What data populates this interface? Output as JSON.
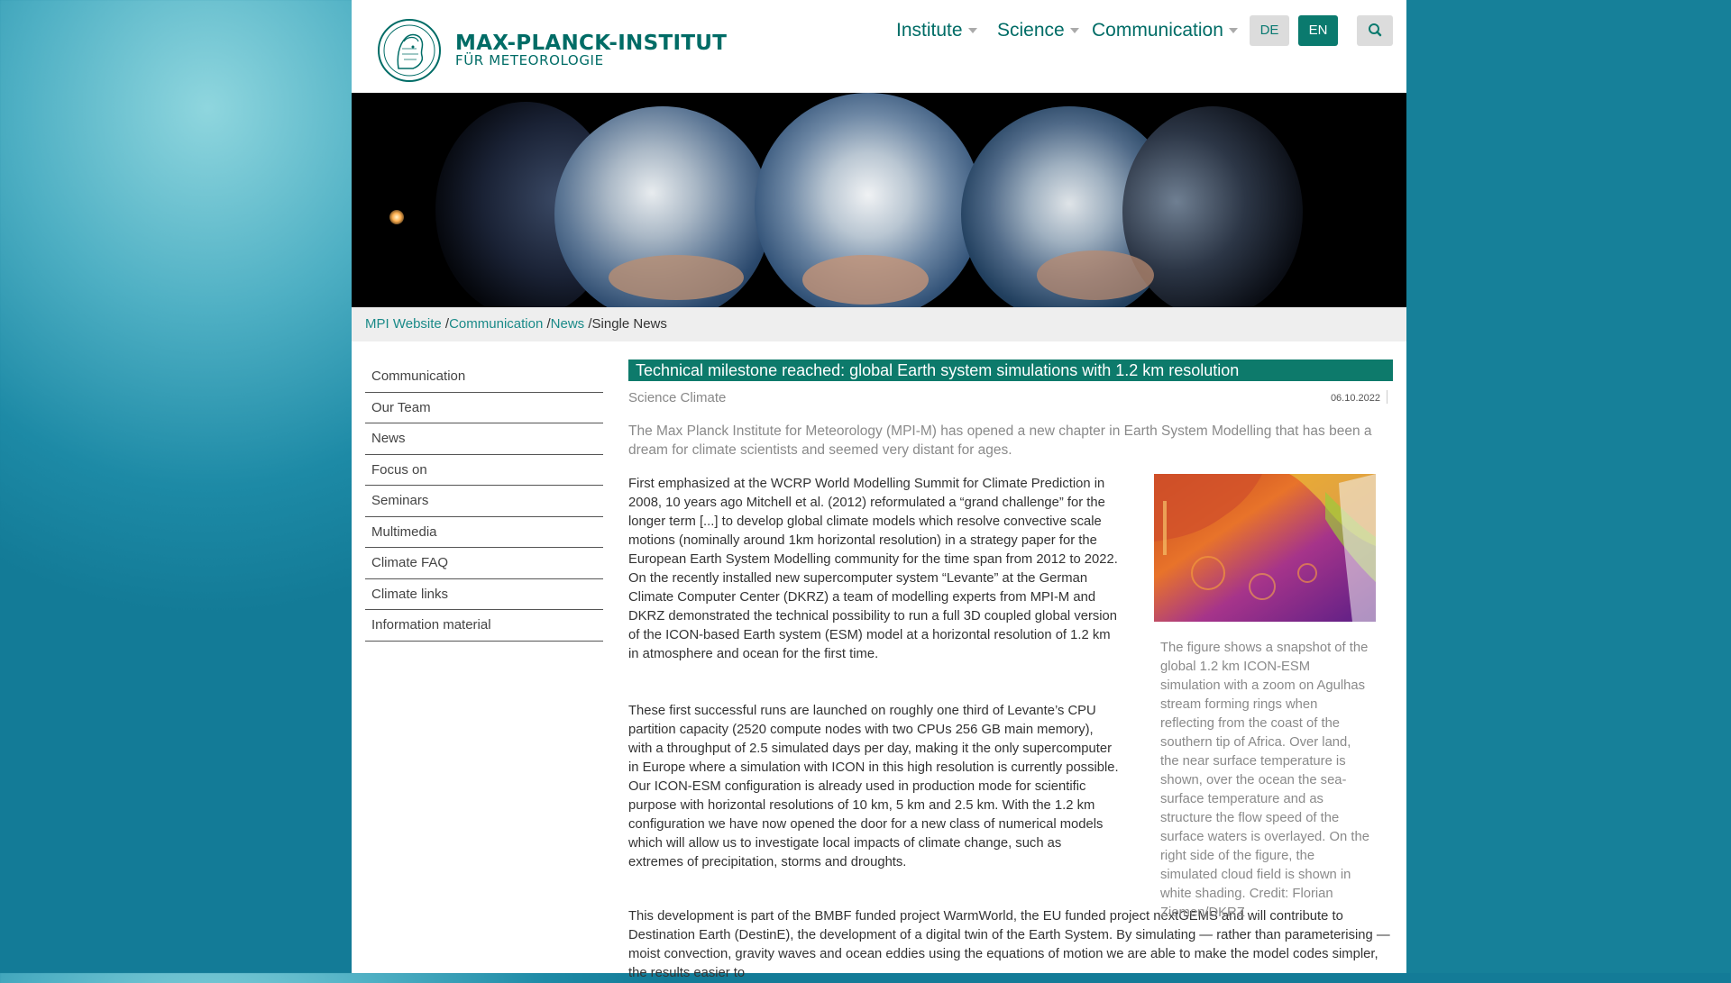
{
  "header": {
    "logo_title": "MAX-PLANCK-INSTITUT",
    "logo_subtitle": "FÜR METEOROLOGIE",
    "nav": [
      "Institute",
      "Science",
      "Communication"
    ],
    "lang_de": "DE",
    "lang_en": "EN",
    "search_icon": "search-icon"
  },
  "breadcrumb": {
    "items": [
      "MPI Website",
      "Communication",
      "News"
    ],
    "current": "Single News",
    "separator": " /"
  },
  "sidebar": {
    "items": [
      "Communication",
      "Our Team",
      "News",
      "Focus on",
      "Seminars",
      "Multimedia",
      "Climate FAQ",
      "Climate links",
      "Information material"
    ]
  },
  "article": {
    "title": "Technical milestone reached: global Earth system simulations with 1.2 km resolution",
    "categories": "Science Climate",
    "date": "06.10.2022",
    "lead": "The Max Planck Institute for Meteorology (MPI-M) has opened a new chapter in Earth System Modelling that has been a dream for climate scientists and seemed very distant for ages.",
    "paragraphs": [
      "First emphasized at the WCRP World Modelling Summit for Climate Prediction in 2008, 10 years ago Mitchell et al. (2012) reformulated a “grand challenge” for the longer term [...] to develop global climate models which resolve convective scale motions (nominally around 1km horizontal resolution) in a strategy paper for the European Earth System Modelling community for the time span from 2012 to 2022. On the recently installed new supercomputer system “Levante” at the German Climate Computer Center (DKRZ) a team of modelling experts from MPI-M and DKRZ demonstrated the technical possibility to run a full 3D coupled global version of the ICON-based Earth system (ESM) model at a horizontal resolution of 1.2 km in atmosphere and ocean for the first time.",
      "These first successful runs are launched on roughly one third of Levante’s CPU partition capacity (2520 compute nodes with two CPUs 256 GB main memory), with a throughput of 2.5 simulated days per day, making it the only supercomputer in Europe where a simulation with ICON in this high resolution is currently possible. Our ICON-ESM configuration is already used in production mode for scientific purpose with horizontal resolutions of 10 km, 5 km and 2.5 km. With the 1.2 km configuration we have now opened the door for a new class of numerical models which will allow us to investigate local impacts of climate change, such as extremes of precipitation, storms and droughts.",
      "This development is part of the BMBF funded project WarmWorld, the EU funded project nextGEMS and will contribute to Destination Earth (DestinE), the development of a digital twin of the Earth System. By simulating — rather than parameterising — moist convection, gravity waves and ocean eddies using the equations of motion we are able to make the model codes simpler, the results easier to"
    ],
    "figure_caption": "The figure shows a snapshot of the global 1.2 km ICON-ESM simulation with a zoom on Agulhas stream forming rings when reflecting from the coast of the southern tip of Africa. Over land, the near surface temperature is shown, over the ocean the sea-surface temperature and as structure the flow speed of the surface waters is overlayed. On the right side of the figure, the simulated cloud field is shown in white shading. Credit: Florian Ziemen/DKRZ"
  }
}
